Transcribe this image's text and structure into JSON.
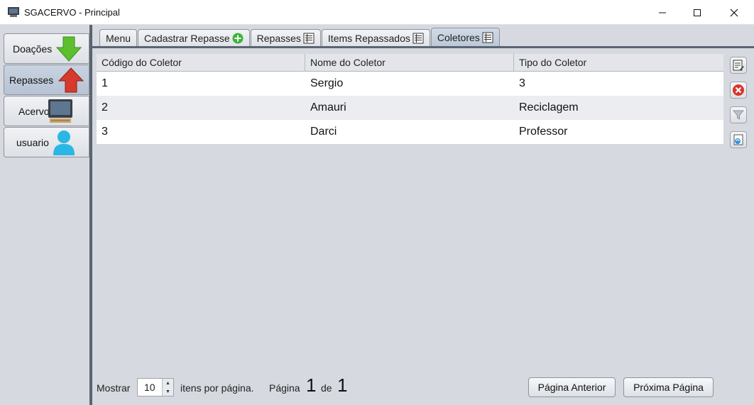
{
  "window": {
    "title": "SGACERVO - Principal"
  },
  "nav": {
    "items": [
      {
        "label": "Doações",
        "icon": "down-arrow-icon"
      },
      {
        "label": "Repasses",
        "icon": "up-arrow-icon"
      },
      {
        "label": "Acervo",
        "icon": "computer-icon"
      },
      {
        "label": "usuario",
        "icon": "user-icon"
      }
    ],
    "active": "Repasses"
  },
  "tabs": [
    {
      "label": "Menu"
    },
    {
      "label": "Cadastrar Repasse"
    },
    {
      "label": "Repasses"
    },
    {
      "label": "Items Repassados"
    },
    {
      "label": "Coletores"
    }
  ],
  "active_tab": "Coletores",
  "table": {
    "columns": [
      "Código do Coletor",
      "Nome do Coletor",
      "Tipo do Coletor"
    ],
    "rows": [
      [
        "1",
        "Sergio",
        "3"
      ],
      [
        "2",
        "Amauri",
        "Reciclagem"
      ],
      [
        "3",
        "Darci",
        "Professor"
      ]
    ]
  },
  "footer": {
    "show_label": "Mostrar",
    "per_page": "10",
    "per_page_suffix": "itens por página.",
    "page_label": "Página",
    "page_current": "1",
    "page_of": "de",
    "page_total": "1",
    "prev_label": "Página Anterior",
    "next_label": "Próxima Página"
  },
  "colors": {
    "panel_bg": "#d6d9df",
    "divider": "#5b6473",
    "delete_red": "#d9342b",
    "add_green": "#3cb43c"
  }
}
